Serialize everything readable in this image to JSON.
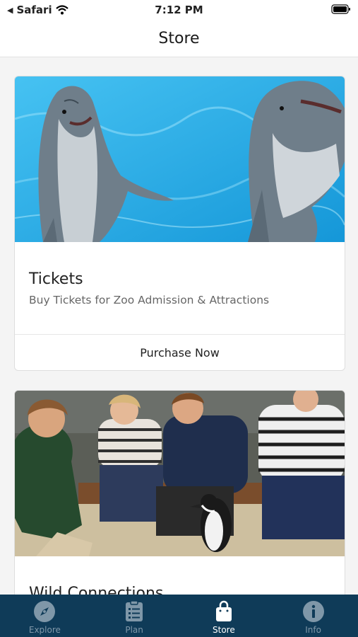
{
  "status_bar": {
    "back_app": "Safari",
    "time": "7:12 PM"
  },
  "header": {
    "title": "Store"
  },
  "cards": [
    {
      "title": "Tickets",
      "subtitle": "Buy Tickets for Zoo Admission & Attractions",
      "action_label": "Purchase Now",
      "image_icon": "dolphins-photo"
    },
    {
      "title": "Wild Connections",
      "image_icon": "penguin-encounter-photo"
    }
  ],
  "tabs": [
    {
      "label": "Explore",
      "icon": "compass-icon",
      "active": false
    },
    {
      "label": "Plan",
      "icon": "checklist-icon",
      "active": false
    },
    {
      "label": "Store",
      "icon": "shopping-bag-icon",
      "active": true
    },
    {
      "label": "Info",
      "icon": "info-icon",
      "active": false
    }
  ],
  "colors": {
    "tab_bar": "#0f3b58",
    "tab_active": "#ffffff",
    "tab_inactive": "#7f97a8",
    "water": "#2aa9e8"
  }
}
